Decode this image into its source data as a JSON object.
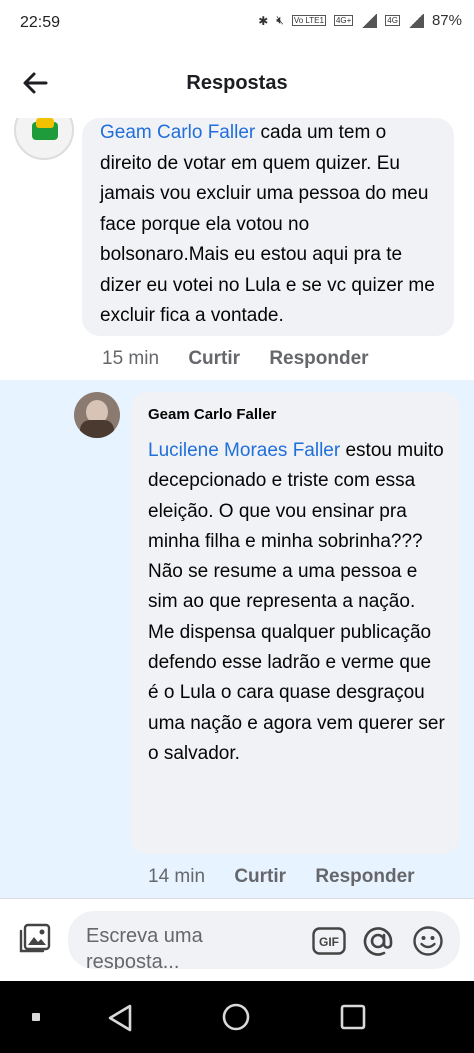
{
  "status_bar": {
    "time": "22:59",
    "volte": "Vo LTE1",
    "net1": "4G+",
    "net2": "4G",
    "battery": "87%"
  },
  "header": {
    "title": "Respostas",
    "back_icon": "back-arrow-icon"
  },
  "comment1": {
    "name": "Geam Carlo Faller",
    "text": " cada um tem o direito de votar em quem quizer. Eu jamais vou excluir uma pessoa do meu face porque ela votou no bolsonaro.Mais eu estou aqui pra te dizer eu votei no Lula e se vc quizer me excluir fica a vontade.",
    "time": "15 min",
    "like": "Curtir",
    "reply": "Responder"
  },
  "comment2": {
    "author": "Geam Carlo Faller",
    "mention": "Lucilene Moraes Faller",
    "text": " estou muito decepcionado e triste com essa eleição. O que vou ensinar pra minha filha e minha sobrinha???\nNão se resume a uma pessoa e sim ao que representa a nação.\nMe dispensa qualquer publicação defendo esse ladrão e verme que é o Lula o cara quase desgraçou uma nação e agora vem querer ser o salvador.",
    "time": "14 min",
    "like": "Curtir",
    "reply": "Responder"
  },
  "composer": {
    "placeholder": "Escreva uma resposta...",
    "icons": [
      "photo-icon",
      "gif-icon",
      "at-icon",
      "emoji-icon"
    ]
  },
  "colors": {
    "link": "#216fdb",
    "bubble": "#f0f2f5",
    "highlight": "#e7f3ff",
    "meta": "#65676b"
  }
}
